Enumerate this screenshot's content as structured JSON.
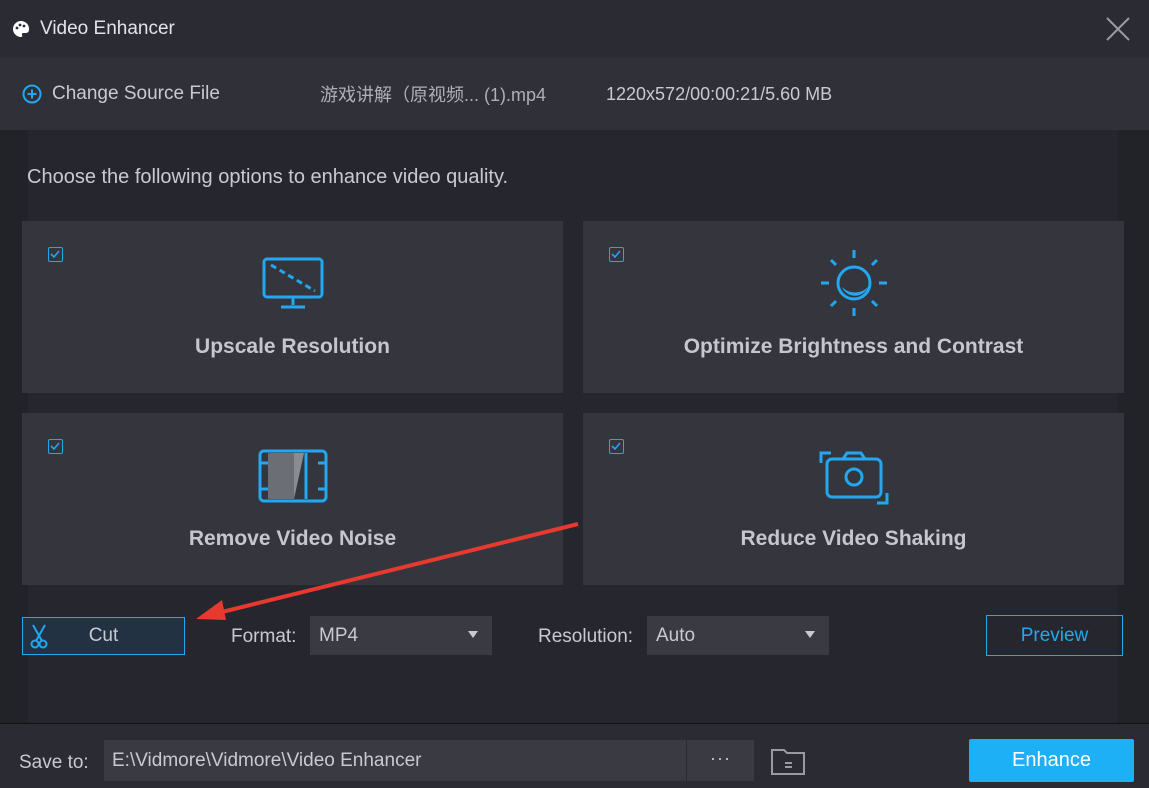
{
  "window": {
    "title": "Video Enhancer"
  },
  "source": {
    "change_label": "Change Source File",
    "file_name": "游戏讲解（原视频... (1).mp4",
    "file_info": "1220x572/00:00:21/5.60 MB"
  },
  "intro": "Choose the following options to enhance video quality.",
  "options": [
    {
      "label": "Upscale Resolution",
      "checked": true
    },
    {
      "label": "Optimize Brightness and Contrast",
      "checked": true
    },
    {
      "label": "Remove Video Noise",
      "checked": true
    },
    {
      "label": "Reduce Video Shaking",
      "checked": true
    }
  ],
  "controls": {
    "cut_label": "Cut",
    "format_label": "Format:",
    "format_value": "MP4",
    "resolution_label": "Resolution:",
    "resolution_value": "Auto",
    "preview_label": "Preview"
  },
  "footer": {
    "save_label": "Save to:",
    "save_path": "E:\\Vidmore\\Vidmore\\Video Enhancer",
    "browse_label": "···",
    "enhance_label": "Enhance"
  },
  "colors": {
    "accent": "#22a7f0",
    "enhance_bg": "#1eb0f6",
    "annotation_arrow": "#e8392f"
  }
}
